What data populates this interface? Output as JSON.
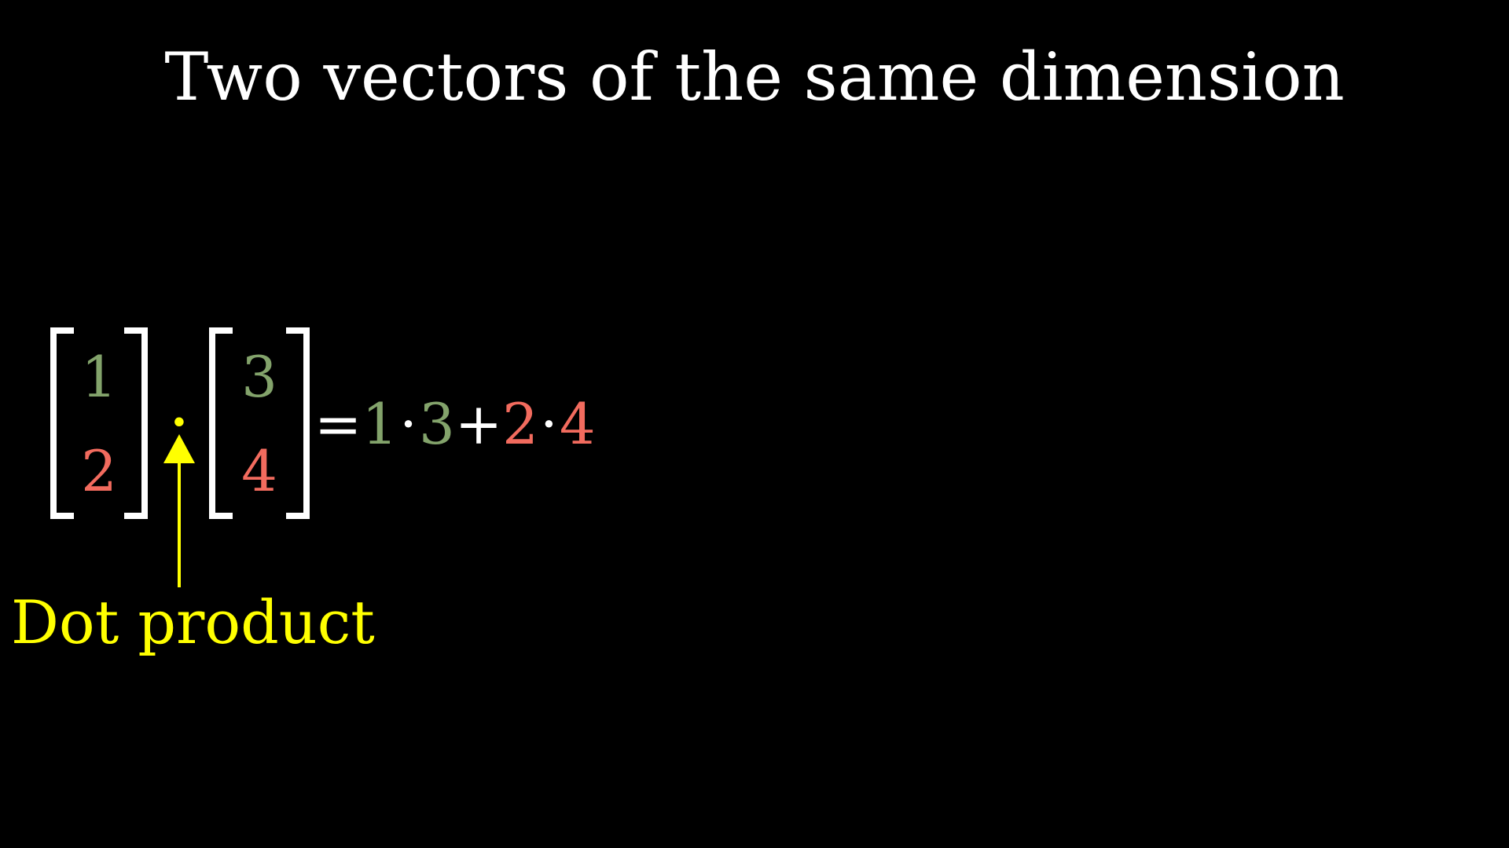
{
  "title": "Two vectors of the same dimension",
  "vector_left": {
    "top": "1",
    "bottom": "2"
  },
  "vector_right": {
    "top": "3",
    "bottom": "4"
  },
  "dot_operator": "·",
  "expression": {
    "equals": "=",
    "term1_a": "1",
    "term1_dot": "·",
    "term1_b": "3",
    "plus": "+",
    "term2_a": "2",
    "term2_dot": "·",
    "term2_b": "4"
  },
  "annotation": {
    "label": "Dot product"
  },
  "colors": {
    "background": "#000000",
    "text": "#ffffff",
    "first_component": "#83a36b",
    "second_component": "#f26b5e",
    "highlight": "#ffff00"
  }
}
